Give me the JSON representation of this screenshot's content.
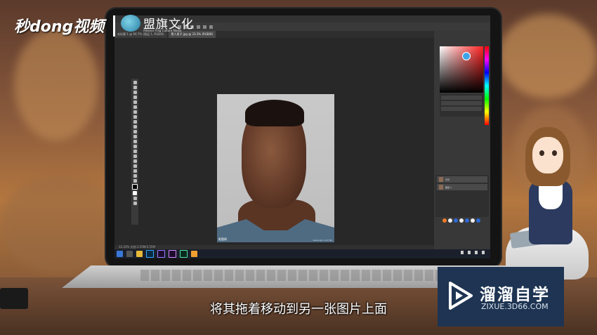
{
  "overlay": {
    "brand_logo_text": "秒dong视频",
    "partner_logo_text": "盟旗文化",
    "partner_logo_sub": "Alliance Flag Culture Media",
    "subtitle": "将其拖着移动到另一张图片上面",
    "zixue_title": "溜溜自学",
    "zixue_url": "ZIXUE.3D66.COM"
  },
  "photoshop": {
    "tabs": [
      "未标题-1 @ 66.7% (图层 1, RGB/8)",
      "黑人男子.jpg @ 33.3% (RGB/8)"
    ],
    "active_tab": 1,
    "tooltip": "移动工具",
    "watermark_left": "昵图网",
    "watermark_right": "www.nipic.com  No.",
    "status": "33.33%  文档:3.55M/3.55M",
    "properties_title": "无属性",
    "layers": [
      {
        "name": "背景"
      },
      {
        "name": "图层 1"
      }
    ],
    "layers_panel_row": "背景"
  },
  "taskbar": {
    "apps": [
      "start",
      "search",
      "explorer",
      "photoshop",
      "premiere",
      "after-effects",
      "audition",
      "media-encoder",
      "chrome"
    ]
  },
  "colors": {
    "accent_blue": "#3fa3e8",
    "zixue_bg": "#1e3452",
    "taskbar": "#1a1f2b"
  }
}
